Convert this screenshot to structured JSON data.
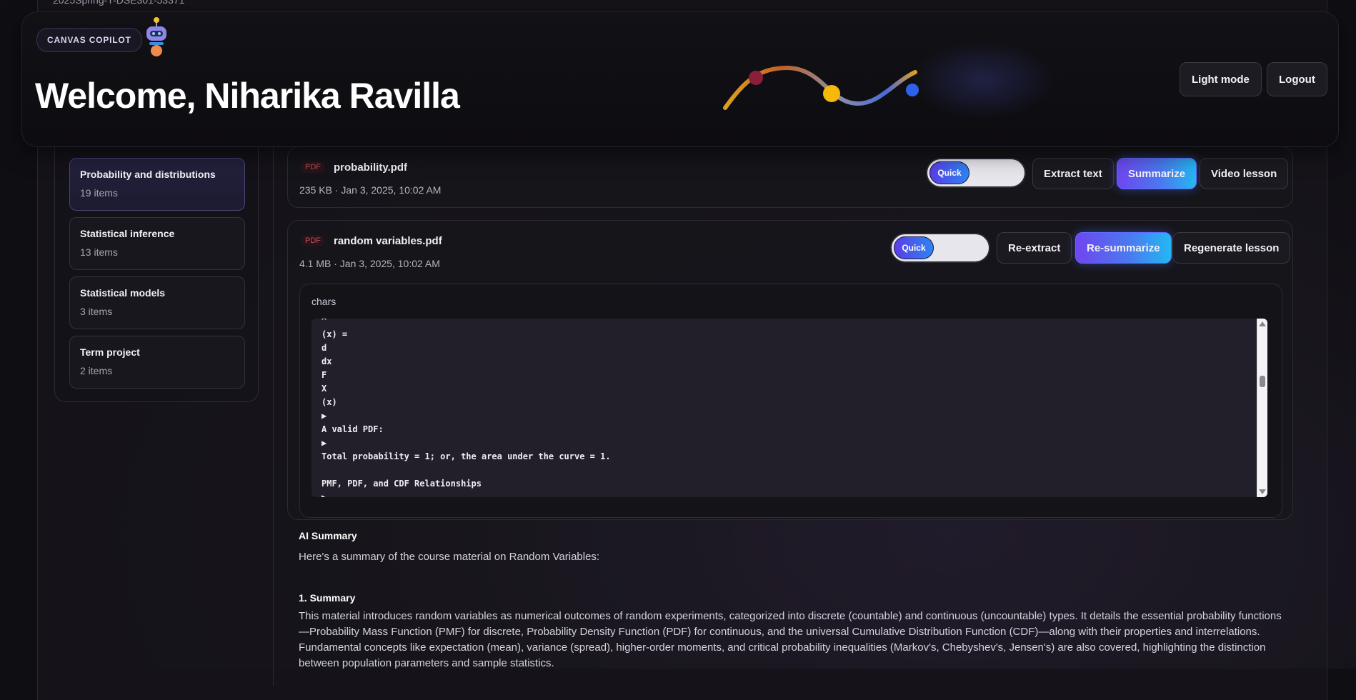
{
  "course": {
    "code": "2025Spring-T-DSE301-53371"
  },
  "header": {
    "brand": "CANVAS COPILOT",
    "welcome": "Welcome, Niharika Ravilla",
    "light_mode_label": "Light mode",
    "logout_label": "Logout"
  },
  "sidebar": {
    "modules": [
      {
        "title": "Probability and distributions",
        "count": "19 items",
        "active": true
      },
      {
        "title": "Statistical inference",
        "count": "13 items"
      },
      {
        "title": "Statistical models",
        "count": "3 items"
      },
      {
        "title": "Term project",
        "count": "2 items"
      }
    ]
  },
  "files": [
    {
      "badge": "PDF",
      "name": "probability.pdf",
      "meta": "235 KB · Jan 3, 2025, 10:02 AM",
      "toggle_label": "Quick",
      "actions": [
        "Extract text",
        "Summarize",
        "Video lesson"
      ]
    },
    {
      "badge": "PDF",
      "name": "random variables.pdf",
      "meta": "4.1 MB · Jan 3, 2025, 10:02 AM",
      "toggle_label": "Quick",
      "actions": [
        "Re-extract",
        "Re-summarize",
        "Regenerate lesson"
      ],
      "chars_label": "chars",
      "extracted_text": "^\n(x) =\nd\ndx\nF\nX\n(x)\n▶\nA valid PDF:\n▶\nTotal probability = 1; or, the area under the curve = 1.\n\nPMF, PDF, and CDF Relationships\n▶"
    }
  ],
  "ai_summary": {
    "heading": "AI Summary",
    "intro": "Here's a summary of the course material on Random Variables:",
    "section_title": "1. Summary",
    "section_text": "This material introduces random variables as numerical outcomes of random experiments, categorized into discrete (countable) and continuous (uncountable) types. It details the essential probability functions—Probability Mass Function (PMF) for discrete, Probability Density Function (PDF) for continuous, and the universal Cumulative Distribution Function (CDF)—along with their properties and interrelations. Fundamental concepts like expectation (mean), variance (spread), higher-order moments, and critical probability inequalities (Markov's, Chebyshev's, Jensen's) are also covered, highlighting the distinction between population parameters and sample statistics."
  },
  "colors": {
    "accent_start": "#6f46f0",
    "accent_end": "#23b8f2",
    "pdf_badge": "#c64a5a"
  }
}
